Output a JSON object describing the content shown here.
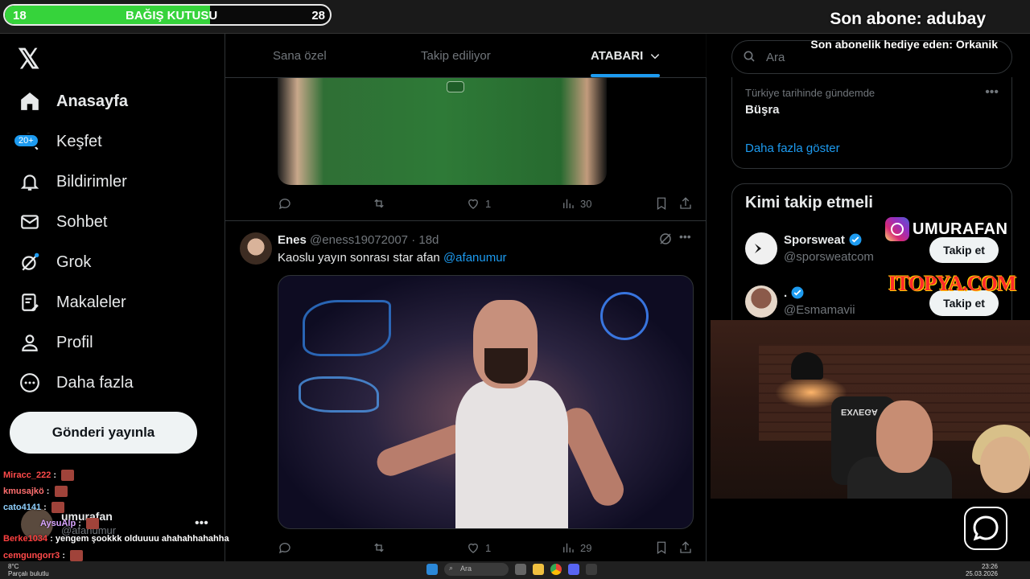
{
  "overlay": {
    "donation": {
      "start": "18",
      "label": "BAĞIŞ KUTUSU",
      "end": "28",
      "progress_fraction": 0.63,
      "fill_color": "#36d33b"
    },
    "last_subscriber": "Son abone: adubay",
    "last_gift": "Son abonelik hediye eden: Orkanik",
    "instagram_handle": "UMURAFAN",
    "sponsor": "ITOPYA.COM"
  },
  "sidebar": {
    "items": [
      {
        "label": "Anasayfa",
        "icon": "home-icon"
      },
      {
        "label": "Keşfet",
        "icon": "search-icon"
      },
      {
        "label": "Bildirimler",
        "icon": "bell-icon"
      },
      {
        "label": "Sohbet",
        "icon": "mail-icon"
      },
      {
        "label": "Grok",
        "icon": "grok-icon"
      },
      {
        "label": "Makaleler",
        "icon": "article-icon"
      },
      {
        "label": "Profil",
        "icon": "person-icon"
      },
      {
        "label": "Daha fazla",
        "icon": "more-circle-icon"
      }
    ],
    "notif_badge": "20+",
    "post_button": "Gönderi yayınla",
    "account": {
      "name": "umurafan",
      "handle": "@afanumur"
    }
  },
  "chat": [
    {
      "user": "Miracc_222",
      "msg": "",
      "color": "#ff4a4a"
    },
    {
      "user": "kmusajkö",
      "msg": "",
      "color": "#ff6f6f"
    },
    {
      "user": "cato4141",
      "msg": "",
      "color": "#8fd1ff"
    },
    {
      "user": "AysuAlp",
      "msg": "",
      "color": "#d9a6ff"
    },
    {
      "user": "Berke1034",
      "msg": "yengem şookkk olduuuu ahahahhahahha",
      "color": "#ff4040"
    },
    {
      "user": "cemgungorr3",
      "msg": "",
      "color": "#ff4a4a"
    }
  ],
  "feed": {
    "tabs": [
      {
        "label": "Sana özel",
        "active": false
      },
      {
        "label": "Takip ediliyor",
        "active": false
      },
      {
        "label": "ATABARI",
        "active": true
      }
    ],
    "tweet1_actions": {
      "likes": "1",
      "views": "30"
    },
    "tweet2": {
      "name": "Enes",
      "handle": "@eness19072007",
      "time": "· 18d",
      "text": "Kaoslu yayın sonrası star afan ",
      "mention": "@afanumur",
      "actions": {
        "likes": "1",
        "views": "29"
      }
    }
  },
  "right": {
    "search_placeholder": "Ara",
    "trend": {
      "context": "Türkiye tarihinde gündemde",
      "name": "Büşra",
      "show_more": "Daha fazla göster"
    },
    "who_to_follow": {
      "title": "Kimi takip etmeli",
      "accounts": [
        {
          "name": "Sporsweat",
          "handle": "@sporsweatcom",
          "button": "Takip et"
        },
        {
          "name": ".",
          "handle": "@Esmamavii",
          "button": "Takip et"
        }
      ]
    }
  },
  "webcam": {
    "chair_text": "EXVEGA"
  },
  "taskbar": {
    "weather_temp": "8°C",
    "weather_text": "Parçalı bulutlu",
    "search_label": "Ara",
    "time": "23:26",
    "date": "25.03.2026"
  },
  "colors": {
    "accent": "#1d9bf0",
    "background": "#000000",
    "border": "#2f3336",
    "muted_text": "#71767b"
  }
}
